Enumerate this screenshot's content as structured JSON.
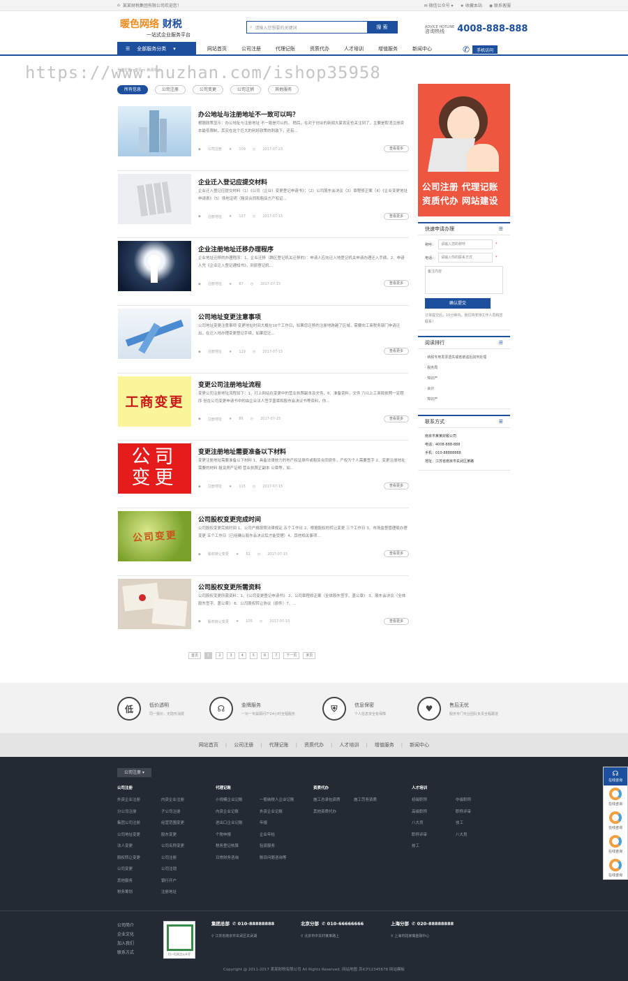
{
  "topbar": {
    "notice": "某某财税集团有限公司欢迎您！",
    "wechat": "微信公众号",
    "favorite": "收藏本站",
    "contact": "联系客服"
  },
  "logo": {
    "brand_a": "暖色网络",
    "brand_b": "财税",
    "slogan": "一站式企业服务平台"
  },
  "search": {
    "placeholder": "请输入您想要的关键词",
    "button": "搜 索"
  },
  "hotline": {
    "label1": "ADVICE HOTLINE",
    "label2": "咨询热线",
    "number": "4008-888-888"
  },
  "nav": {
    "category_button": "全部服务分类",
    "items": [
      "网站首页",
      "公司注册",
      "代理记账",
      "资质代办",
      "人才培训",
      "增值服务",
      "新闻中心"
    ],
    "mobile": "手机访问"
  },
  "watermark": "https://www.huzhan.com/ishop35958",
  "breadcrumb": "当前位置：首页 > 新闻中心",
  "filters": [
    "所有信息",
    "公司注册",
    "公司变更",
    "公司注销",
    "其他服务"
  ],
  "articles": [
    {
      "title": "办公地址与注册地址不一致可以吗？",
      "desc": "根据政策显示：办公地址与注册地址 不一致是可以的。 稍后，在对于创业的新闻大家肯定也关注到了，主要是取消注册资本最低限制，其实在这个巨大的利好政策的刺激下，还有...",
      "tag": "公司注册",
      "views": "109",
      "date": "2017-07-23",
      "more": "查看更多"
    },
    {
      "title": "企业迁入登记应提交材料",
      "desc": "企业迁入登记应提交材料（1）《公司（企业）变更登记申请书》；（2）公司股东会决议（3）章程修正案（4）《企业变更地址申请表》（5）场地证明（租赁合同和租赁方产权证...",
      "tag": "注册地址",
      "views": "137",
      "date": "2017-07-15",
      "more": "查看更多"
    },
    {
      "title": "企业注册地址迁移办理程序",
      "desc": "企业地址迁移的办理程序：1、企业迁移（跨区登记机关迁移的）：申请人应向迁入地登记机关申请办理迁入手续。2、申请人凭《企业迁入登记通知书》，到原登记机...",
      "tag": "注册地址",
      "views": "87",
      "date": "2017-07-15",
      "more": "查看更多"
    },
    {
      "title": "公司地址变更注意事项",
      "desc": "公司地址变更注意事项 变更地址时间大概在10个工作日，如果您迁移的注册地跨越了区域，需要向工商税务部门申请迁出，在迁入地办理变更登记手续，如果您迁...",
      "tag": "注册地址",
      "views": "129",
      "date": "2017-07-15",
      "more": "查看更多"
    },
    {
      "title": "变更公司注册地址流程",
      "desc": "变更公司注册地址流程如下：1、打上网站在变更中的营业执照副本及文件，6、准备资料，文件 六以上工商局依照一定程序 但在公司变更申请书中的由企业法人签字盖章和股东会决议书等资料，你...",
      "tag": "注册地址",
      "views": "86",
      "date": "2017-07-15",
      "more": "查看更多"
    },
    {
      "title": "变更注册地址需要准备以下材料",
      "desc": "变更注册地址需要准备以下材料 1、具备法律效力的地产权证原件或租赁合同原件，产权为个人需要签字 2、变更注册地址需要的材料 租赁房产证明 营业执照正副本 公章等，如...",
      "tag": "注册地址",
      "views": "115",
      "date": "2017-07-15",
      "more": "查看更多"
    },
    {
      "title": "公司股权变更完成时间",
      "desc": "公司股权变更完成时间 1、公司严格按照法律规定 五个工作日 2、根据股权的转让变更 三个工作日 3、市场监督管理局办理变更 五个工作日（已经确认股东会决议后才能受理）4、其他相关事项...",
      "tag": "股权转让变更",
      "views": "51",
      "date": "2017-07-15",
      "more": "查看更多"
    },
    {
      "title": "公司股权变更所需资料",
      "desc": "公司股权变更所需资料：1、《公司变更登记申请书》 2、公司章程修正案（全体股东签字、盖公章） 3、股东会决议（全体股东签字、盖公章） 6、公司股权转让协议（原件）7、...",
      "tag": "股权转让变更",
      "views": "105",
      "date": "2017-07-15",
      "more": "查看更多"
    }
  ],
  "thumbs": {
    "t5": "工商变更",
    "t6a": "公司",
    "t6b": "变更",
    "t7": "公司变更"
  },
  "pagination": [
    "首页",
    "1",
    "2",
    "3",
    "4",
    "5",
    "6",
    "7",
    "下一页",
    "末页"
  ],
  "sidebar": {
    "banner_line1": "公司注册 代理记账",
    "banner_line2": "资质代办 网站建设",
    "form_title": "快速申请办理",
    "form_name_label": "称呼：",
    "form_name_ph": "请输入您的称呼",
    "form_phone_label": "电话：",
    "form_phone_ph": "请输入你的联系方式",
    "form_note_ph": "备注内容",
    "form_submit": "确认提交",
    "form_note": "订单提交后，10分钟内，我们将安排工作人员和您联系！",
    "rank_title": "阅读排行",
    "rank_items": [
      "纳税专用发票遗失或者被盗后如何处理",
      "税务局",
      "知识产",
      "会计",
      "知识产"
    ],
    "contact_title": "联系方式",
    "contact_company": "南京市某某财税公司",
    "contact_phone": "电话：4008-888-888",
    "contact_mobile": "手机：010-88888888",
    "contact_addr": "地址：江苏省南京市玄武区某路"
  },
  "features": [
    {
      "icon": "低",
      "title": "低价透明",
      "sub": "同一报价，无隐形消费"
    },
    {
      "icon": "金",
      "title": "金牌服务",
      "sub": "一对一专属顾问7*24小时全程服务"
    },
    {
      "icon": "盾",
      "title": "信息保密",
      "sub": "个人信息安全有保障"
    },
    {
      "icon": "心",
      "title": "售后无忧",
      "sub": "服务专门专业团队负责全程跟进"
    }
  ],
  "footer_nav": [
    "网站首页",
    "公司注册",
    "代理记账",
    "资质代办",
    "人才培训",
    "增值服务",
    "新闻中心"
  ],
  "footer": {
    "tab": "公司注册",
    "cols": [
      {
        "head": "公司注册",
        "items": [
          "外资企业注册",
          "内资企业注册",
          "分公司注册",
          "子公司注册",
          "集团公司注册",
          "经营范围变更",
          "公司地址变更",
          "股东变更",
          "法人变更",
          "公司名称变更",
          "股权转让变更",
          "公司注册",
          "公司变更",
          "公司注销",
          "其他服务",
          "银行开户",
          "税务筹划",
          "注册地址"
        ]
      },
      {
        "head": "代理记账",
        "items": [
          "小规模企业记账",
          "一般纳税人企业记账",
          "内资企业记账",
          "外资企业记账",
          "进出口企业记账",
          "年报",
          "个税申报",
          "企业年检",
          "税务登记核算",
          "验资服务",
          "日常财务咨询",
          "账目问题咨询等"
        ]
      },
      {
        "head": "资质代办",
        "items": [
          "施工总承包资质",
          "施工劳务资质",
          "其他资质代办"
        ]
      },
      {
        "head": "人才培训",
        "items": [
          "初级职称",
          "中级职称",
          "高级职称",
          "职称评审",
          "八大员",
          "技工",
          "职称评审",
          "八大员",
          "技工"
        ]
      }
    ],
    "links": [
      "公司简介",
      "企业文化",
      "加入我们",
      "联系方式"
    ],
    "qr_label": "扫一扫关注公众号",
    "offices": [
      {
        "name": "集团总部",
        "phone": "010-88888888",
        "addr": "江苏省南京市玄武区玄武湖"
      },
      {
        "name": "北京分部",
        "phone": "010-66666666",
        "addr": "北京市中关村某某路上"
      },
      {
        "name": "上海分部",
        "phone": "020-88888888",
        "addr": "上海市陆家嘴金融中心"
      }
    ],
    "copyright": "Copyright @ 2011-2017 某某财税有限公司 All Rights Reserved.   网站地图   苏ICP12345678   网站模板"
  },
  "floatbar": [
    "在线咨询",
    "在线咨询",
    "在线咨询",
    "在线咨询",
    "在线咨询"
  ],
  "colors": {
    "primary": "#1c4f9e",
    "banner": "#ef5640",
    "footer": "#232a33"
  }
}
